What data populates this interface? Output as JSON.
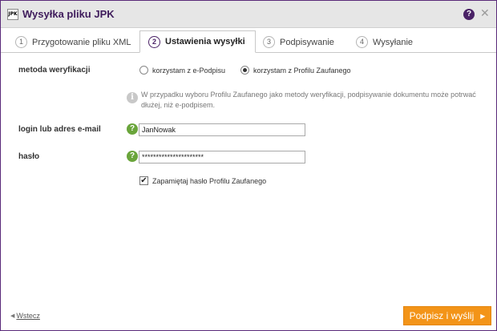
{
  "window": {
    "logo_text": "JPK",
    "title": "Wysyłka pliku JPK",
    "help_glyph": "?",
    "close_glyph": "✕"
  },
  "tabs": [
    {
      "number": "1",
      "label": "Przygotowanie pliku XML",
      "active": false
    },
    {
      "number": "2",
      "label": "Ustawienia wysyłki",
      "active": true
    },
    {
      "number": "3",
      "label": "Podpisywanie",
      "active": false
    },
    {
      "number": "4",
      "label": "Wysyłanie",
      "active": false
    }
  ],
  "form": {
    "verification_label": "metoda weryfikacji",
    "option_epodpis": "korzystam z e-Podpisu",
    "option_profil": "korzystam z Profilu Zaufanego",
    "selected_option": "profil",
    "info_glyph": "i",
    "info_text": "W przypadku wyboru Profilu Zaufanego jako metody weryfikacji, podpisywanie dokumentu może potrwać dłużej, niż e-podpisem.",
    "login_label": "login lub adres e-mail",
    "login_value": "JanNowak",
    "password_label": "hasło",
    "password_value": "**********************",
    "hint_glyph": "?",
    "remember_label": "Zapamiętaj hasło Profilu Zaufanego",
    "remember_checked": true
  },
  "footer": {
    "back_label": "Wstecz",
    "submit_label": "Podpisz i wyślij"
  },
  "colors": {
    "accent": "#4a2266",
    "button": "#f39418",
    "hint": "#6aa53b"
  },
  "icons": [
    "app-logo",
    "help-icon",
    "close-icon",
    "info-icon",
    "hint-icon",
    "back-arrow-icon",
    "next-arrow-icon",
    "checkmark-icon"
  ]
}
